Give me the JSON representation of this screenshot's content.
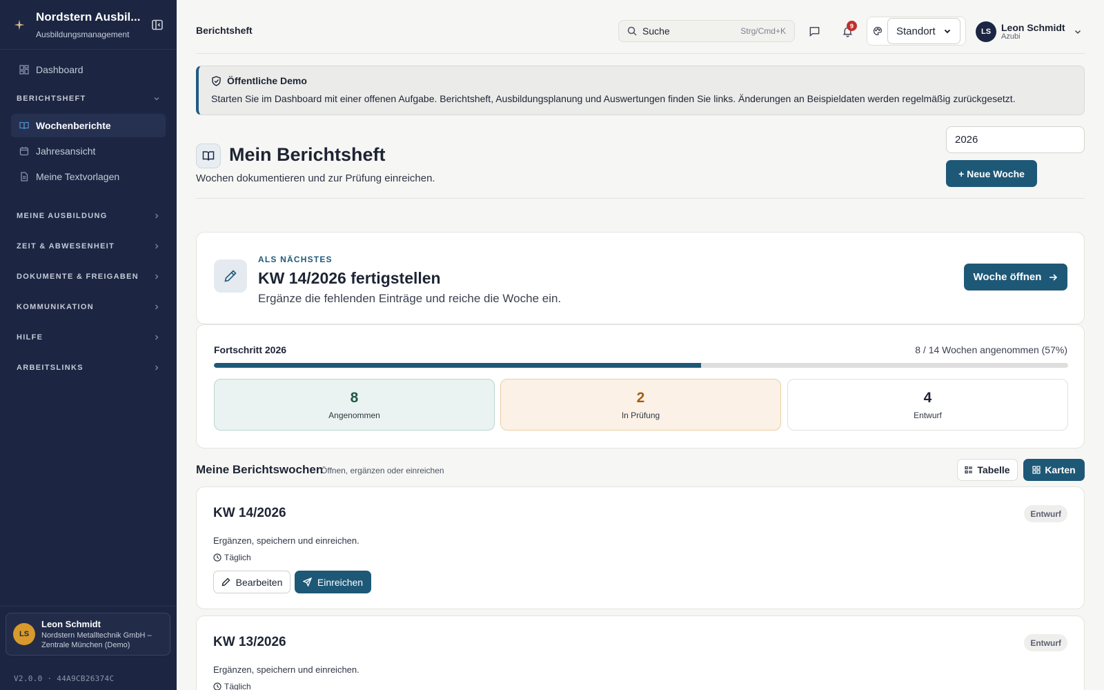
{
  "app": {
    "brand_title": "Nordstern Ausbil...",
    "brand_subtitle": "Ausbildungsmanagement",
    "version": "V2.0.0 · 44A9CB26374C"
  },
  "sidebar": {
    "dashboard": "Dashboard",
    "berichtsheft_section": "BERICHTSHEFT",
    "items": [
      {
        "label": "Wochenberichte",
        "icon": "book-open-icon",
        "active": true
      },
      {
        "label": "Jahresansicht",
        "icon": "calendar-icon",
        "active": false
      },
      {
        "label": "Meine Textvorlagen",
        "icon": "file-text-icon",
        "active": false
      }
    ],
    "sections": [
      "MEINE AUSBILDUNG",
      "ZEIT & ABWESENHEIT",
      "DOKUMENTE & FREIGABEN",
      "KOMMUNIKATION",
      "HILFE",
      "ARBEITSLINKS"
    ],
    "user": {
      "initials": "LS",
      "name": "Leon Schmidt",
      "org": "Nordstern Metalltechnik GmbH – Zentrale München (Demo)"
    }
  },
  "topbar": {
    "breadcrumb": "Berichtsheft",
    "search_placeholder": "Suche",
    "search_shortcut": "Strg/Cmd+K",
    "notification_count": "9",
    "location_selected": "Standort",
    "user_initials": "LS",
    "user_name": "Leon Schmidt",
    "user_role": "Azubi"
  },
  "demo_banner": {
    "title": "Öffentliche Demo",
    "text": "Starten Sie im Dashboard mit einer offenen Aufgabe. Berichtsheft, Ausbildungsplanung und Auswertungen finden Sie links. Änderungen an Beispieldaten werden regelmäßig zurückgesetzt."
  },
  "page": {
    "title": "Mein Berichtsheft",
    "subtitle": "Wochen dokumentieren und zur Prüfung einreichen.",
    "year_value": "2026",
    "new_week_label": "+ Neue Woche"
  },
  "next_task": {
    "eyebrow": "ALS NÄCHSTES",
    "title": "KW 14/2026 fertigstellen",
    "subtitle": "Ergänze die fehlenden Einträge und reiche die Woche ein.",
    "button_label": "Woche öffnen"
  },
  "progress": {
    "label": "Fortschritt 2026",
    "meta": "8 / 14 Wochen angenommen (57%)",
    "percent": 57,
    "stats": [
      {
        "value": "8",
        "label": "Angenommen"
      },
      {
        "value": "2",
        "label": "In Prüfung"
      },
      {
        "value": "4",
        "label": "Entwurf"
      }
    ]
  },
  "weeks_list": {
    "title": "Meine Berichtswochen",
    "subtitle": "Öffnen, ergänzen oder einreichen",
    "view_table": "Tabelle",
    "view_cards": "Karten",
    "weeks": [
      {
        "title": "KW 14/2026",
        "status": "Entwurf",
        "description": "Ergänzen, speichern und einreichen.",
        "frequency": "Täglich",
        "edit_label": "Bearbeiten",
        "submit_label": "Einreichen"
      },
      {
        "title": "KW 13/2026",
        "status": "Entwurf",
        "description": "Ergänzen, speichern und einreichen.",
        "frequency": "Täglich"
      }
    ]
  },
  "colors": {
    "sidebar_bg": "#1c2642",
    "primary": "#1e5877",
    "accepted": "#1f5a43",
    "in_review": "#a35e14",
    "notification": "#c0302c"
  }
}
